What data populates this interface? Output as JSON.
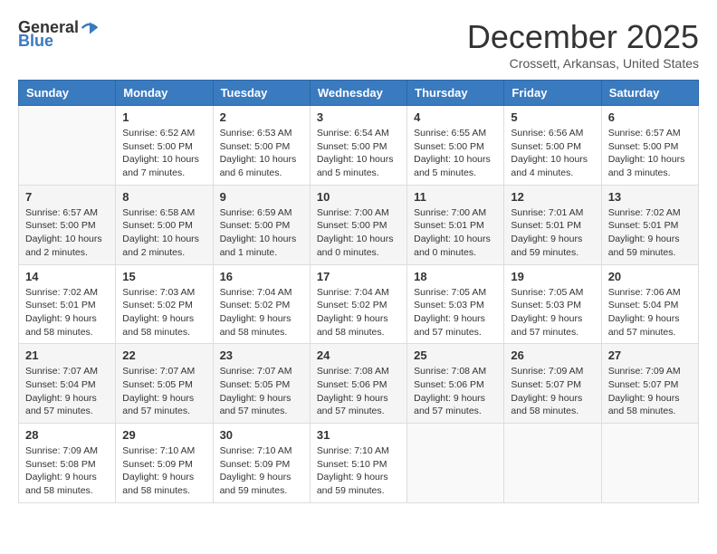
{
  "logo": {
    "general": "General",
    "blue": "Blue"
  },
  "title": "December 2025",
  "location": "Crossett, Arkansas, United States",
  "days_of_week": [
    "Sunday",
    "Monday",
    "Tuesday",
    "Wednesday",
    "Thursday",
    "Friday",
    "Saturday"
  ],
  "weeks": [
    [
      {
        "day": "",
        "info": ""
      },
      {
        "day": "1",
        "info": "Sunrise: 6:52 AM\nSunset: 5:00 PM\nDaylight: 10 hours\nand 7 minutes."
      },
      {
        "day": "2",
        "info": "Sunrise: 6:53 AM\nSunset: 5:00 PM\nDaylight: 10 hours\nand 6 minutes."
      },
      {
        "day": "3",
        "info": "Sunrise: 6:54 AM\nSunset: 5:00 PM\nDaylight: 10 hours\nand 5 minutes."
      },
      {
        "day": "4",
        "info": "Sunrise: 6:55 AM\nSunset: 5:00 PM\nDaylight: 10 hours\nand 5 minutes."
      },
      {
        "day": "5",
        "info": "Sunrise: 6:56 AM\nSunset: 5:00 PM\nDaylight: 10 hours\nand 4 minutes."
      },
      {
        "day": "6",
        "info": "Sunrise: 6:57 AM\nSunset: 5:00 PM\nDaylight: 10 hours\nand 3 minutes."
      }
    ],
    [
      {
        "day": "7",
        "info": "Sunrise: 6:57 AM\nSunset: 5:00 PM\nDaylight: 10 hours\nand 2 minutes."
      },
      {
        "day": "8",
        "info": "Sunrise: 6:58 AM\nSunset: 5:00 PM\nDaylight: 10 hours\nand 2 minutes."
      },
      {
        "day": "9",
        "info": "Sunrise: 6:59 AM\nSunset: 5:00 PM\nDaylight: 10 hours\nand 1 minute."
      },
      {
        "day": "10",
        "info": "Sunrise: 7:00 AM\nSunset: 5:00 PM\nDaylight: 10 hours\nand 0 minutes."
      },
      {
        "day": "11",
        "info": "Sunrise: 7:00 AM\nSunset: 5:01 PM\nDaylight: 10 hours\nand 0 minutes."
      },
      {
        "day": "12",
        "info": "Sunrise: 7:01 AM\nSunset: 5:01 PM\nDaylight: 9 hours\nand 59 minutes."
      },
      {
        "day": "13",
        "info": "Sunrise: 7:02 AM\nSunset: 5:01 PM\nDaylight: 9 hours\nand 59 minutes."
      }
    ],
    [
      {
        "day": "14",
        "info": "Sunrise: 7:02 AM\nSunset: 5:01 PM\nDaylight: 9 hours\nand 58 minutes."
      },
      {
        "day": "15",
        "info": "Sunrise: 7:03 AM\nSunset: 5:02 PM\nDaylight: 9 hours\nand 58 minutes."
      },
      {
        "day": "16",
        "info": "Sunrise: 7:04 AM\nSunset: 5:02 PM\nDaylight: 9 hours\nand 58 minutes."
      },
      {
        "day": "17",
        "info": "Sunrise: 7:04 AM\nSunset: 5:02 PM\nDaylight: 9 hours\nand 58 minutes."
      },
      {
        "day": "18",
        "info": "Sunrise: 7:05 AM\nSunset: 5:03 PM\nDaylight: 9 hours\nand 57 minutes."
      },
      {
        "day": "19",
        "info": "Sunrise: 7:05 AM\nSunset: 5:03 PM\nDaylight: 9 hours\nand 57 minutes."
      },
      {
        "day": "20",
        "info": "Sunrise: 7:06 AM\nSunset: 5:04 PM\nDaylight: 9 hours\nand 57 minutes."
      }
    ],
    [
      {
        "day": "21",
        "info": "Sunrise: 7:07 AM\nSunset: 5:04 PM\nDaylight: 9 hours\nand 57 minutes."
      },
      {
        "day": "22",
        "info": "Sunrise: 7:07 AM\nSunset: 5:05 PM\nDaylight: 9 hours\nand 57 minutes."
      },
      {
        "day": "23",
        "info": "Sunrise: 7:07 AM\nSunset: 5:05 PM\nDaylight: 9 hours\nand 57 minutes."
      },
      {
        "day": "24",
        "info": "Sunrise: 7:08 AM\nSunset: 5:06 PM\nDaylight: 9 hours\nand 57 minutes."
      },
      {
        "day": "25",
        "info": "Sunrise: 7:08 AM\nSunset: 5:06 PM\nDaylight: 9 hours\nand 57 minutes."
      },
      {
        "day": "26",
        "info": "Sunrise: 7:09 AM\nSunset: 5:07 PM\nDaylight: 9 hours\nand 58 minutes."
      },
      {
        "day": "27",
        "info": "Sunrise: 7:09 AM\nSunset: 5:07 PM\nDaylight: 9 hours\nand 58 minutes."
      }
    ],
    [
      {
        "day": "28",
        "info": "Sunrise: 7:09 AM\nSunset: 5:08 PM\nDaylight: 9 hours\nand 58 minutes."
      },
      {
        "day": "29",
        "info": "Sunrise: 7:10 AM\nSunset: 5:09 PM\nDaylight: 9 hours\nand 58 minutes."
      },
      {
        "day": "30",
        "info": "Sunrise: 7:10 AM\nSunset: 5:09 PM\nDaylight: 9 hours\nand 59 minutes."
      },
      {
        "day": "31",
        "info": "Sunrise: 7:10 AM\nSunset: 5:10 PM\nDaylight: 9 hours\nand 59 minutes."
      },
      {
        "day": "",
        "info": ""
      },
      {
        "day": "",
        "info": ""
      },
      {
        "day": "",
        "info": ""
      }
    ]
  ]
}
